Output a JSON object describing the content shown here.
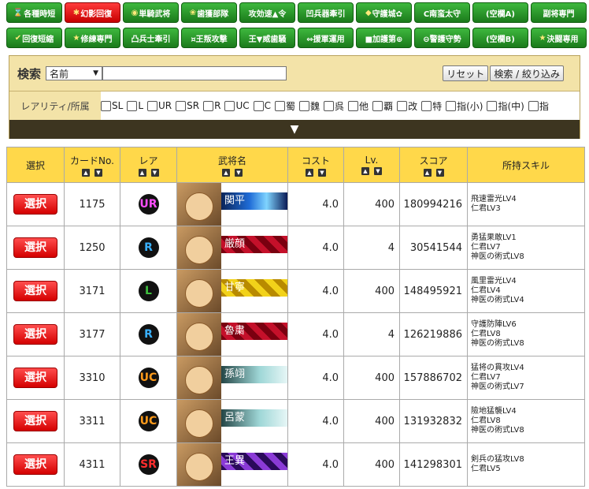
{
  "tabs_row1": [
    {
      "icon": "⌛",
      "label": "各種時短",
      "active": false
    },
    {
      "icon": "✱",
      "label": "幻影回復",
      "active": true
    },
    {
      "icon": "◉",
      "label": "単騎武将",
      "active": false
    },
    {
      "icon": "❀",
      "label": "歯獲部隊",
      "active": false
    },
    {
      "icon": "",
      "label": "攻効速▲令",
      "active": false
    },
    {
      "icon": "",
      "label": "凹兵器牽引",
      "active": false
    },
    {
      "icon": "◆",
      "label": "守護城✿",
      "active": false
    },
    {
      "icon": "",
      "label": "C南蛮太守",
      "active": false
    },
    {
      "icon": "",
      "label": "(空欄A)",
      "active": false
    },
    {
      "icon": "",
      "label": "副将専門",
      "active": false
    }
  ],
  "tabs_row2": [
    {
      "icon": "✔",
      "label": "回復短縮",
      "active": false
    },
    {
      "icon": "★",
      "label": "修練専門",
      "active": false
    },
    {
      "icon": "",
      "label": "凸兵士牽引",
      "active": false
    },
    {
      "icon": "",
      "label": "¤王叛攻撃",
      "active": false
    },
    {
      "icon": "",
      "label": "王▼威歯騒",
      "active": false
    },
    {
      "icon": "",
      "label": "⇔援軍運用",
      "active": false
    },
    {
      "icon": "",
      "label": "■加護第⊕",
      "active": false
    },
    {
      "icon": "",
      "label": "⊖警護守勢",
      "active": false
    },
    {
      "icon": "",
      "label": "(空欄B)",
      "active": false
    },
    {
      "icon": "★",
      "label": "決闘専用",
      "active": false
    }
  ],
  "search": {
    "label": "検索",
    "select_value": "名前",
    "text_value": "",
    "reset_label": "リセット",
    "filter_label": "検索 / 絞り込み",
    "rarity_label": "レアリティ/所属",
    "options": [
      "SL",
      "L",
      "UR",
      "SR",
      "R",
      "UC",
      "C",
      "蜀",
      "魏",
      "呉",
      "他",
      "覇",
      "改",
      "特",
      "指(小)",
      "指(中)",
      "指"
    ],
    "expand_glyph": "▼"
  },
  "table": {
    "headers": {
      "select": "選択",
      "card_no": "カードNo.",
      "rare": "レア",
      "name": "武将名",
      "cost": "コスト",
      "lv": "Lv.",
      "score": "スコア",
      "skills": "所持スキル"
    },
    "sort_up": "▲",
    "sort_down": "▼",
    "button_label": "選択",
    "rows": [
      {
        "card_no": "1175",
        "rare": "UR",
        "rare_color": "#ff4dff",
        "name": "関平",
        "bar": "linear-gradient(90deg,#081c4a 0%,#1f6bd6 45%,#7fd4ff 70%,#0a1a55 100%)",
        "cost": "4.0",
        "lv": "400",
        "score": "180994216",
        "skills": [
          "飛速雷光LV4",
          "仁君LV3"
        ]
      },
      {
        "card_no": "1250",
        "rare": "R",
        "rare_color": "#39b0ff",
        "name": "厳顔",
        "bar": "repeating-linear-gradient(45deg,#7a0010 0 8px,#c4102a 8px 16px)",
        "cost": "4.0",
        "lv": "4",
        "score": "30541544",
        "skills": [
          "勇猛果敢LV1",
          "仁君LV7",
          "神医の術式LV8"
        ]
      },
      {
        "card_no": "3171",
        "rare": "L",
        "rare_color": "#3ec03e",
        "name": "甘寧",
        "bar": "repeating-linear-gradient(45deg,#b88a00 0 8px,#f2d21a 8px 16px)",
        "cost": "4.0",
        "lv": "400",
        "score": "148495921",
        "skills": [
          "風里雷光LV4",
          "仁君LV4",
          "神医の術式LV4"
        ]
      },
      {
        "card_no": "3177",
        "rare": "R",
        "rare_color": "#39b0ff",
        "name": "魯粛",
        "bar": "repeating-linear-gradient(45deg,#7a0010 0 8px,#c4102a 8px 16px)",
        "cost": "4.0",
        "lv": "4",
        "score": "126219886",
        "skills": [
          "守護防陣LV6",
          "仁君LV8",
          "神医の術式LV8"
        ]
      },
      {
        "card_no": "3310",
        "rare": "UC",
        "rare_color": "#ff9a1a",
        "name": "孫翊",
        "bar": "linear-gradient(90deg,#1a3a3a,#9fd7d7 60%,#e6f6f6)",
        "cost": "4.0",
        "lv": "400",
        "score": "157886702",
        "skills": [
          "猛将の貫攻LV4",
          "仁君LV7",
          "神医の術式LV7"
        ]
      },
      {
        "card_no": "3311",
        "rare": "UC",
        "rare_color": "#ff9a1a",
        "name": "呂蒙",
        "bar": "linear-gradient(90deg,#1a3a3a,#9fd7d7 60%,#e6f6f6)",
        "cost": "4.0",
        "lv": "400",
        "score": "131932832",
        "skills": [
          "險地猛襲LV4",
          "仁君LV8",
          "神医の術式LV8"
        ]
      },
      {
        "card_no": "4311",
        "rare": "SR",
        "rare_color": "#ff2d2d",
        "name": "王異",
        "bar": "repeating-linear-gradient(45deg,#2a0a5a 0 8px,#8a3ad6 8px 16px)",
        "cost": "4.0",
        "lv": "400",
        "score": "141298301",
        "skills": [
          "剣兵の猛攻LV8",
          "仁君LV5"
        ]
      }
    ]
  }
}
